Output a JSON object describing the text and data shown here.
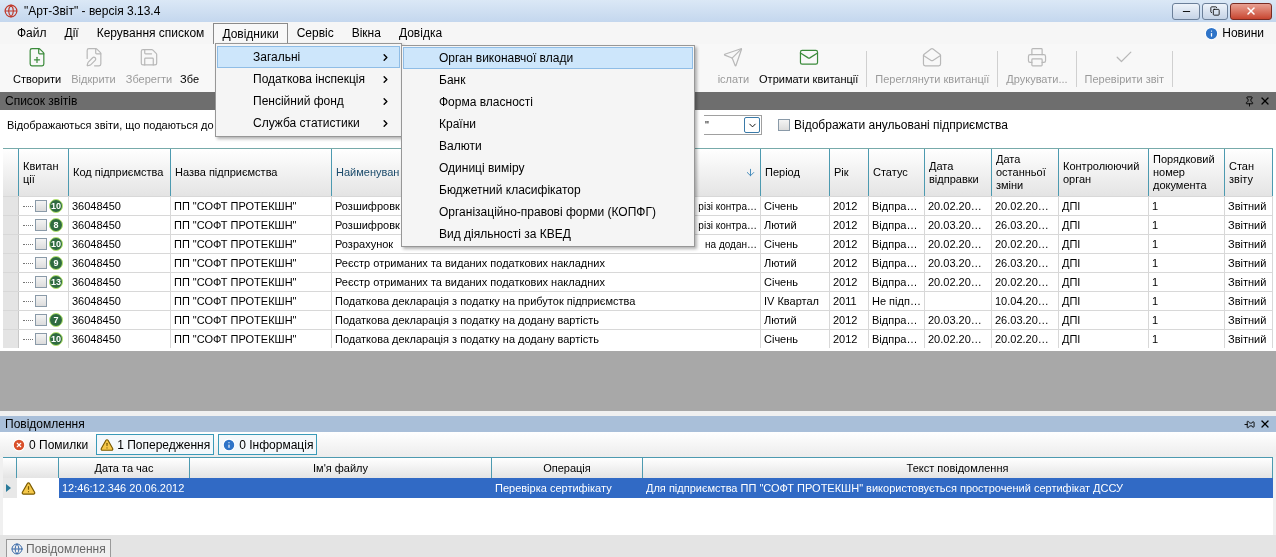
{
  "window": {
    "title": "\"Арт-Звіт\" - версія 3.13.4"
  },
  "menu_bar": {
    "items": [
      {
        "label": "Файл",
        "selected": false
      },
      {
        "label": "Дії",
        "selected": false
      },
      {
        "label": "Керування списком",
        "selected": false
      },
      {
        "label": "Довідники",
        "selected": true
      },
      {
        "label": "Сервіс",
        "selected": false
      },
      {
        "label": "Вікна",
        "selected": false
      },
      {
        "label": "Довідка",
        "selected": false
      }
    ],
    "news": "Новини"
  },
  "dropdown_menu": {
    "items": [
      {
        "label": "Загальні",
        "selected": true
      },
      {
        "label": "Податкова інспекція",
        "selected": false
      },
      {
        "label": "Пенсійний фонд",
        "selected": false
      },
      {
        "label": "Служба статистики",
        "selected": false
      }
    ]
  },
  "submenu": {
    "items": [
      {
        "label": "Орган виконавчої влади",
        "selected": true
      },
      {
        "label": "Банк",
        "selected": false
      },
      {
        "label": "Форма власності",
        "selected": false
      },
      {
        "label": "Країни",
        "selected": false
      },
      {
        "label": "Валюти",
        "selected": false
      },
      {
        "label": "Одиниці виміру",
        "selected": false
      },
      {
        "label": "Бюджетний класифікатор",
        "selected": false
      },
      {
        "label": "Організаційно-правові форми (КОПФГ)",
        "selected": false
      },
      {
        "label": "Вид діяльності за КВЕД",
        "selected": false
      }
    ]
  },
  "toolbar": {
    "left_items": [
      {
        "label": "Створити",
        "disabled": false
      },
      {
        "label": "Відкрити",
        "disabled": true
      },
      {
        "label": "Зберегти",
        "disabled": true
      },
      {
        "label": "Збе",
        "disabled": false
      }
    ],
    "right_items": [
      {
        "label": "іслати",
        "disabled": true
      },
      {
        "label": "Отримати квитанції",
        "disabled": false
      },
      {
        "label": "Переглянути квитанції",
        "disabled": true
      },
      {
        "label": "Друкувати...",
        "disabled": true
      },
      {
        "label": "Перевірити звіт",
        "disabled": true
      }
    ]
  },
  "reports_panel": {
    "title": "Список звітів",
    "filter_text": "Відображаються звіти, що подаються до",
    "combo_value": "\"",
    "show_cancelled": {
      "label": "Відображати анульовані підприємства",
      "checked": false
    }
  },
  "table": {
    "columns": [
      {
        "label": "Квитанції",
        "sorted": false
      },
      {
        "label": "Код підприємства",
        "sorted": false
      },
      {
        "label": "Назва підприємства",
        "sorted": false
      },
      {
        "label": "Найменуван",
        "sorted": true
      },
      {
        "label": "Період",
        "sorted": false
      },
      {
        "label": "Рік",
        "sorted": false
      },
      {
        "label": "Статус",
        "sorted": false
      },
      {
        "label": "Дата відправки",
        "sorted": false
      },
      {
        "label": "Дата останньої зміни",
        "sorted": false
      },
      {
        "label": "Контролюючий орган",
        "sorted": false
      },
      {
        "label": "Порядковий номер документа",
        "sorted": false
      },
      {
        "label": "Стан звіту",
        "sorted": false
      }
    ],
    "rows": [
      {
        "checked": false,
        "receipts": "10",
        "code": "36048450",
        "company": "ПП \"СОФТ ПРОТЕКШН\"",
        "name": "Розшифровк",
        "name_end": "різі контра…",
        "period": "Січень",
        "year": "2012",
        "status": "Відпра…",
        "sent": "20.02.20…",
        "modified": "20.02.20…",
        "authority": "ДПІ",
        "number": "1",
        "state": "Звітний"
      },
      {
        "checked": false,
        "receipts": "8",
        "code": "36048450",
        "company": "ПП \"СОФТ ПРОТЕКШН\"",
        "name": "Розшифровк",
        "name_end": "різі контра…",
        "period": "Лютий",
        "year": "2012",
        "status": "Відпра…",
        "sent": "20.03.20…",
        "modified": "26.03.20…",
        "authority": "ДПІ",
        "number": "1",
        "state": "Звітний"
      },
      {
        "checked": false,
        "receipts": "10",
        "code": "36048450",
        "company": "ПП \"СОФТ ПРОТЕКШН\"",
        "name": "Розрахунок",
        "name_end": "на додан…",
        "period": "Січень",
        "year": "2012",
        "status": "Відпра…",
        "sent": "20.02.20…",
        "modified": "20.02.20…",
        "authority": "ДПІ",
        "number": "1",
        "state": "Звітний"
      },
      {
        "checked": false,
        "receipts": "9",
        "code": "36048450",
        "company": "ПП \"СОФТ ПРОТЕКШН\"",
        "name": "Реєстр отриманих та виданих податкових накладних",
        "period": "Лютий",
        "year": "2012",
        "status": "Відпра…",
        "sent": "20.03.20…",
        "modified": "26.03.20…",
        "authority": "ДПІ",
        "number": "1",
        "state": "Звітний"
      },
      {
        "checked": false,
        "receipts": "13",
        "code": "36048450",
        "company": "ПП \"СОФТ ПРОТЕКШН\"",
        "name": "Реєстр отриманих та виданих податкових накладних",
        "period": "Січень",
        "year": "2012",
        "status": "Відпра…",
        "sent": "20.02.20…",
        "modified": "20.02.20…",
        "authority": "ДПІ",
        "number": "1",
        "state": "Звітний"
      },
      {
        "checked": false,
        "code": "36048450",
        "company": "ПП \"СОФТ ПРОТЕКШН\"",
        "name": "Податкова декларація з податку на прибуток підприємства",
        "period": "IV Квартал",
        "year": "2011",
        "status": "Не підп…",
        "modified": "10.04.20…",
        "authority": "ДПІ",
        "number": "1",
        "state": "Звітний"
      },
      {
        "checked": false,
        "receipts": "7",
        "code": "36048450",
        "company": "ПП \"СОФТ ПРОТЕКШН\"",
        "name": "Податкова декларація з податку на додану вартість",
        "period": "Лютий",
        "year": "2012",
        "status": "Відпра…",
        "sent": "20.03.20…",
        "modified": "26.03.20…",
        "authority": "ДПІ",
        "number": "1",
        "state": "Звітний"
      },
      {
        "checked": false,
        "receipts": "10",
        "code": "36048450",
        "company": "ПП \"СОФТ ПРОТЕКШН\"",
        "name": "Податкова декларація з податку на додану вартість",
        "period": "Січень",
        "year": "2012",
        "status": "Відпра…",
        "sent": "20.02.20…",
        "modified": "20.02.20…",
        "authority": "ДПІ",
        "number": "1",
        "state": "Звітний"
      }
    ]
  },
  "messages_panel": {
    "title": "Повідомлення",
    "filters": [
      {
        "label": "0 Помилки",
        "checked": false
      },
      {
        "label": "1 Попередження",
        "checked": true
      },
      {
        "label": "0 Інформація",
        "checked": true
      }
    ],
    "columns": [
      "Дата та час",
      "Ім'я файлу",
      "Операція",
      "Текст повідомлення"
    ],
    "rows": [
      {
        "selected": true,
        "time": "12:46:12.346 20.06.2012",
        "operation": "Перевірка сертифікату",
        "text": "Для підприємства ПП \"СОФТ ПРОТЕКШН\" використовується прострочений сертифікат ДССУ"
      }
    ],
    "bottom_tab": "Повідомлення"
  }
}
